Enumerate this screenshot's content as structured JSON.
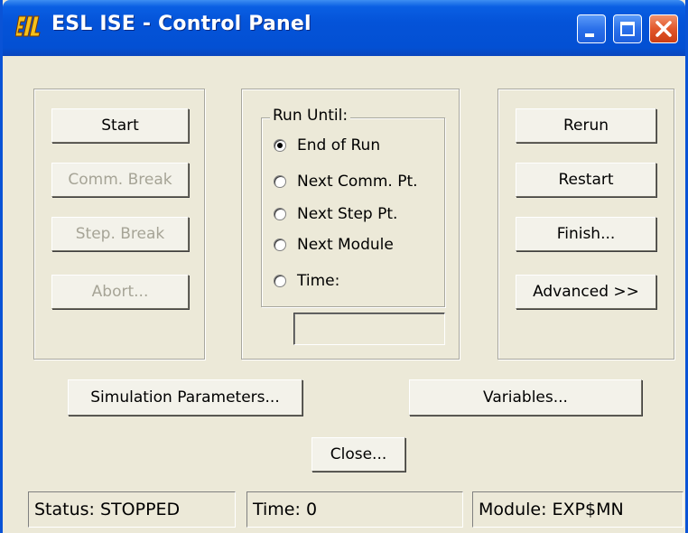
{
  "window": {
    "title": "ESL ISE - Control Panel"
  },
  "left_panel": {
    "start": "Start",
    "comm_break": "Comm. Break",
    "step_break": "Step. Break",
    "abort": "Abort..."
  },
  "run_until": {
    "label": "Run Until:",
    "options": [
      {
        "label": "End of Run",
        "checked": true
      },
      {
        "label": "Next Comm. Pt.",
        "checked": false
      },
      {
        "label": "Next Step Pt.",
        "checked": false
      },
      {
        "label": "Next Module",
        "checked": false
      },
      {
        "label": "Time:",
        "checked": false
      }
    ],
    "time_value": ""
  },
  "right_panel": {
    "rerun": "Rerun",
    "restart": "Restart",
    "finish": "Finish...",
    "advanced": "Advanced >>"
  },
  "bottom": {
    "simulation_parameters": "Simulation Parameters...",
    "variables": "Variables...",
    "close": "Close..."
  },
  "status_bar": {
    "status": "Status: STOPPED",
    "time": "Time: 0",
    "module": "Module: EXP$MN"
  },
  "colors": {
    "titlebar": "#0453d8",
    "face": "#ece9d8",
    "disabled_text": "#a6a496",
    "close_button": "#e2572b"
  }
}
